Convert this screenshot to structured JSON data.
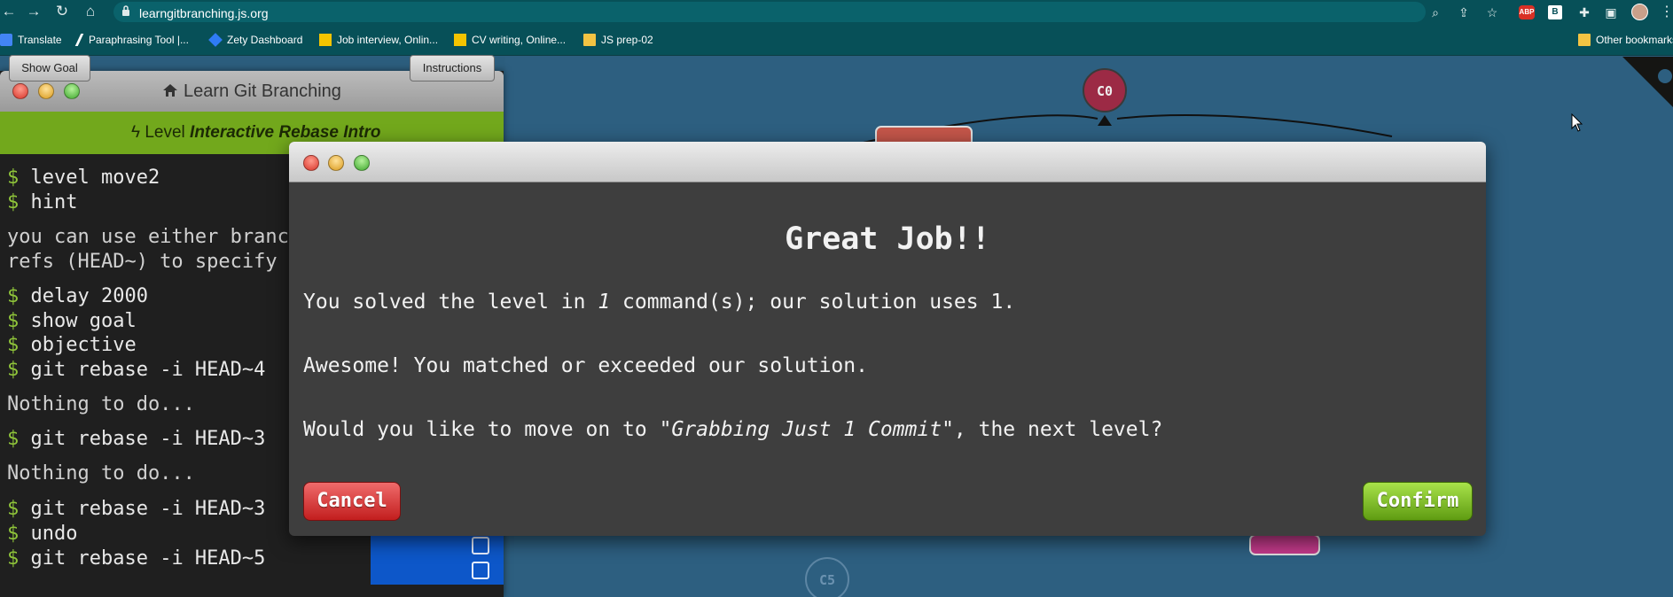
{
  "browser": {
    "url": "learngitbranching.js.org",
    "bookmarks": [
      "Translate",
      "Paraphrasing Tool |...",
      "Zety Dashboard",
      "Job interview, Onlin...",
      "CV writing, Online...",
      "JS prep-02"
    ],
    "other_bookmarks": "Other bookmarks",
    "extension_abp": "ABP",
    "extension_b": "B"
  },
  "command_window": {
    "title": "Learn Git Branching",
    "show_goal_label": "Show Goal",
    "level_prefix": "Level",
    "level_name": "Interactive Rebase Intro",
    "instructions_label": "Instructions",
    "log": [
      {
        "type": "cmd",
        "text": "level move2"
      },
      {
        "type": "cmd",
        "text": "hint"
      },
      {
        "type": "out",
        "text": "you can use either branch names or relative"
      },
      {
        "type": "out",
        "text": "refs (HEAD~) to specify the rebase target"
      },
      {
        "type": "cmd",
        "text": "delay 2000"
      },
      {
        "type": "cmd",
        "text": "show goal"
      },
      {
        "type": "cmd",
        "text": "objective"
      },
      {
        "type": "cmd",
        "text": "git rebase -i HEAD~4"
      },
      {
        "type": "out",
        "text": "Nothing to do..."
      },
      {
        "type": "cmd",
        "text": "git rebase -i HEAD~3"
      },
      {
        "type": "out",
        "text": "Nothing to do..."
      },
      {
        "type": "cmd",
        "text": "git rebase -i HEAD~3"
      },
      {
        "type": "cmd",
        "text": "undo"
      },
      {
        "type": "cmd",
        "text": "git rebase -i HEAD~5"
      }
    ]
  },
  "visualization": {
    "commits": [
      "C0",
      "C5"
    ]
  },
  "modal": {
    "heading": "Great Job!!",
    "line1_a": "You solved the level in ",
    "line1_num": "1",
    "line1_b": " command(s); our solution uses 1.",
    "line2": "Awesome! You matched or exceeded our solution.",
    "line3_a": "Would you like to move on to ",
    "line3_level": "\"Grabbing Just 1 Commit\"",
    "line3_b": ", the next level?",
    "cancel_label": "Cancel",
    "confirm_label": "Confirm"
  },
  "colors": {
    "browser_teal": "#075058",
    "canvas_blue": "#2d5f80",
    "toolbar_green": "#72a81c",
    "confirm_green": "#7cbd22",
    "cancel_red": "#d83232",
    "commit_fill": "#9c2a45"
  }
}
